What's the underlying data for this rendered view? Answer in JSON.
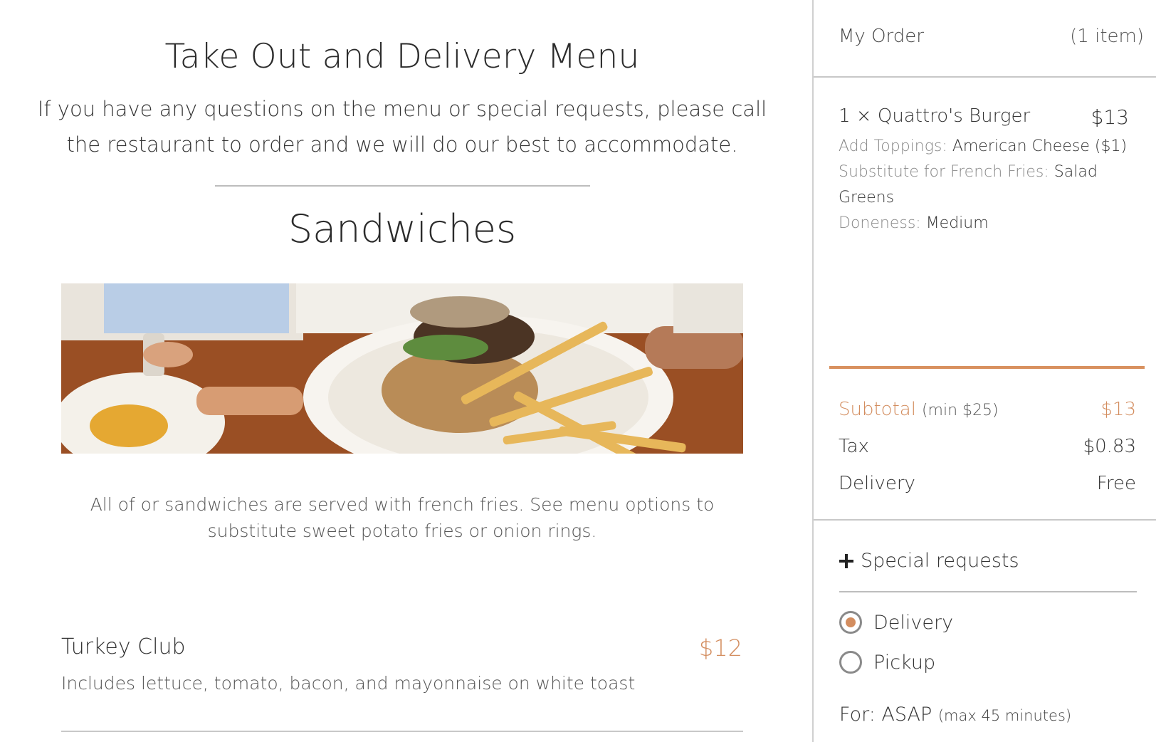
{
  "menu": {
    "title": "Take Out and Delivery Menu",
    "intro": "If you have any questions on the menu or special requests, please call the restaurant to order and we will do our best to accommodate.",
    "section": {
      "title": "Sandwiches",
      "description": "All of or sandwiches are served with french fries. See menu options to substitute sweet potato fries or onion rings.",
      "hero_icon": "burger-and-fries-photo"
    },
    "items": [
      {
        "name": "Turkey Club",
        "price": "$12",
        "description": "Includes lettuce, tomato, bacon, and mayonnaise on white toast"
      }
    ]
  },
  "cart": {
    "title": "My Order",
    "count": "(1 item)",
    "order": {
      "line": "1 × Quattro's Burger",
      "price": "$13",
      "options": [
        {
          "label": "Add Toppings:",
          "value": "American Cheese ($1)"
        },
        {
          "label": "Substitute for French Fries:",
          "value": "Salad Greens"
        },
        {
          "label": "Doneness:",
          "value": "Medium"
        }
      ]
    },
    "totals": {
      "subtotal_label": "Subtotal",
      "subtotal_min": "(min $25)",
      "subtotal_value": "$13",
      "tax_label": "Tax",
      "tax_value": "$0.83",
      "delivery_label": "Delivery",
      "delivery_value": "Free"
    },
    "special_requests_label": "Special requests",
    "fulfillment": {
      "options": [
        "Delivery",
        "Pickup"
      ],
      "selected": "Delivery"
    },
    "for_label": "For: ASAP",
    "for_max": "(max 45 minutes)"
  },
  "colors": {
    "accent": "#d38d5f",
    "text": "#333333",
    "divider": "#c8c8c8"
  }
}
